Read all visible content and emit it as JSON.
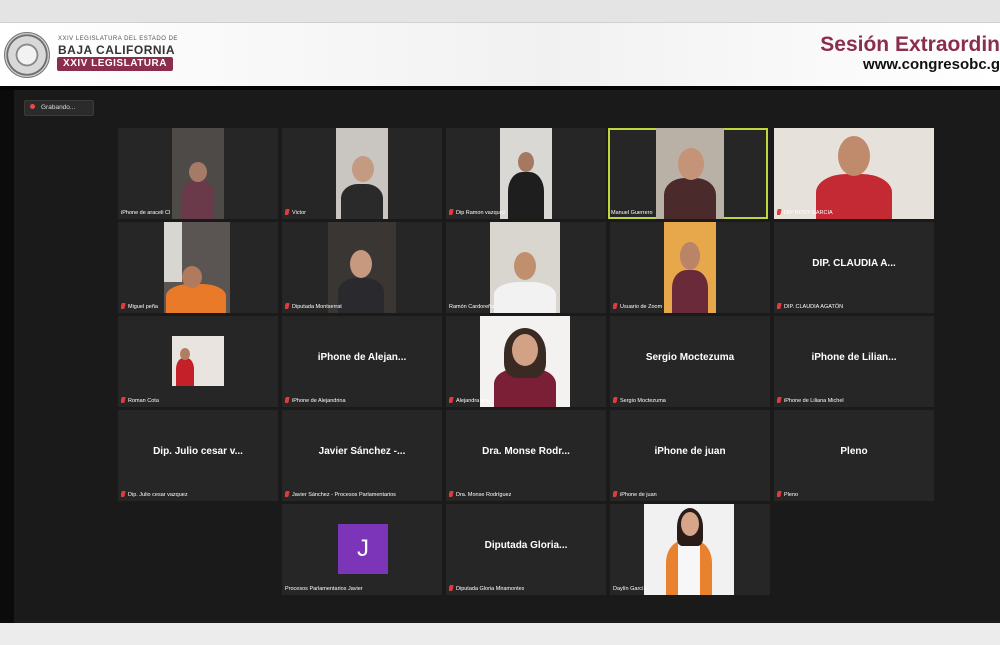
{
  "header": {
    "logo_line1": "XXIV LEGISLATURA DEL ESTADO DE",
    "logo_line2": "BAJA CALIFORNIA",
    "logo_line3": "XXIV LEGISLATURA",
    "session_title": "Sesión Extraordin",
    "session_url": "www.congresobc.g"
  },
  "recording": {
    "label": "Grabando..."
  },
  "colors": {
    "brand": "#8b2d4f",
    "active_speaker": "#c2d53b",
    "muted_mic": "#e33b3b",
    "tile_bg": "#262626"
  },
  "participants": [
    {
      "label": "iPhone de araceli Cl",
      "muted": false,
      "video": true
    },
    {
      "label": "Victor",
      "muted": true,
      "video": true
    },
    {
      "label": "Dip Ramon vazquez",
      "muted": true,
      "video": true
    },
    {
      "label": "Manuel Guerrero",
      "muted": false,
      "video": true,
      "active": true
    },
    {
      "label": "DIP ROSY GARCIA",
      "muted": true,
      "video": true
    },
    {
      "label": "Miguel peña",
      "muted": true,
      "video": true
    },
    {
      "label": "Diputada Montserrat",
      "muted": true,
      "video": true
    },
    {
      "label": "Ramón Cardoreña",
      "muted": false,
      "video": true
    },
    {
      "label": "Usuario de Zoom",
      "muted": true,
      "video": true
    },
    {
      "label": "DIP. CLAUDIA AGATÓN",
      "display": "DIP. CLAUDIA A...",
      "muted": true,
      "video": false
    },
    {
      "label": "Roman Cota",
      "muted": true,
      "video": true
    },
    {
      "label": "iPhone de Alejandrina",
      "display": "iPhone de Alejan...",
      "muted": true,
      "video": false
    },
    {
      "label": "Alejandra ang",
      "muted": true,
      "video": true
    },
    {
      "label": "Sergio Moctezuma",
      "display": "Sergio Moctezuma",
      "muted": true,
      "video": false
    },
    {
      "label": "iPhone de Liliana Michel",
      "display": "iPhone de Lilian...",
      "muted": true,
      "video": false
    },
    {
      "label": "Dip. Julio cesar vazquez",
      "display": "Dip. Julio cesar v...",
      "muted": true,
      "video": false
    },
    {
      "label": "Javier Sánchez - Procesos Parlamentarios",
      "display": "Javier Sánchez -...",
      "muted": true,
      "video": false
    },
    {
      "label": "Dra. Monse Rodríguez",
      "display": "Dra. Monse Rodr...",
      "muted": true,
      "video": false
    },
    {
      "label": "iPhone de juan",
      "display": "iPhone de juan",
      "muted": true,
      "video": false
    },
    {
      "label": "Pleno",
      "display": "Pleno",
      "muted": true,
      "video": false
    },
    {
      "label": "Procesos Parlamentarios Javier",
      "muted": false,
      "video": false,
      "avatar": "J"
    },
    {
      "label": "Diputada Gloria Miramontes",
      "display": "Diputada Gloria...",
      "muted": true,
      "video": false
    },
    {
      "label": "Daylín García",
      "muted": false,
      "video": true
    }
  ]
}
